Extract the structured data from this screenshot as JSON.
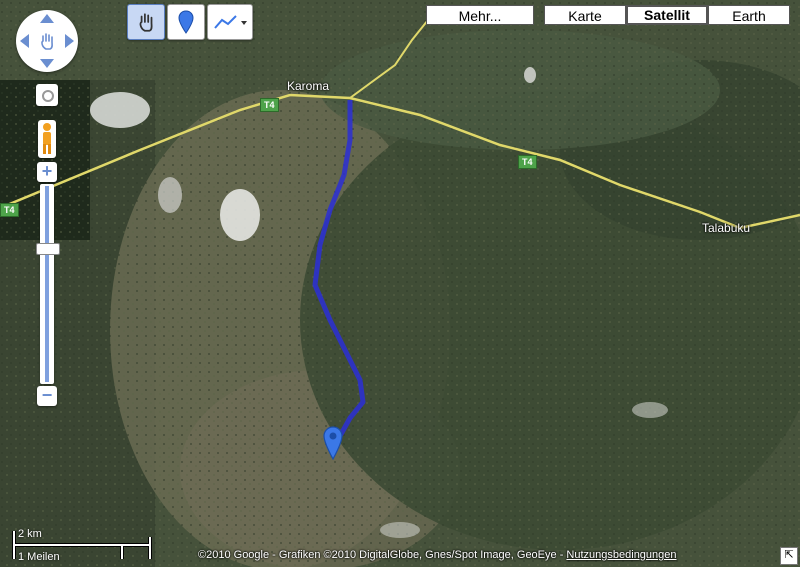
{
  "map": {
    "type_buttons": {
      "more": "Mehr...",
      "map": "Karte",
      "satellite": "Satellit",
      "earth": "Earth"
    },
    "places": {
      "karoma": "Karoma",
      "talabuku": "Talabuku"
    },
    "road_shields": {
      "road_a": "T4",
      "road_b": "T4",
      "road_c": "T4"
    },
    "scale": {
      "metric": "2 km",
      "imperial": "1 Meilen"
    },
    "copyright": {
      "text": "©2010 Google - Grafiken ©2010 DigitalGlobe, Gnes/Spot Image, GeoEye -",
      "terms_link": "Nutzungsbedingungen"
    },
    "colors": {
      "route": "#2b2fd6",
      "road": "#e0d86a",
      "marker": "#3b78e7"
    }
  }
}
